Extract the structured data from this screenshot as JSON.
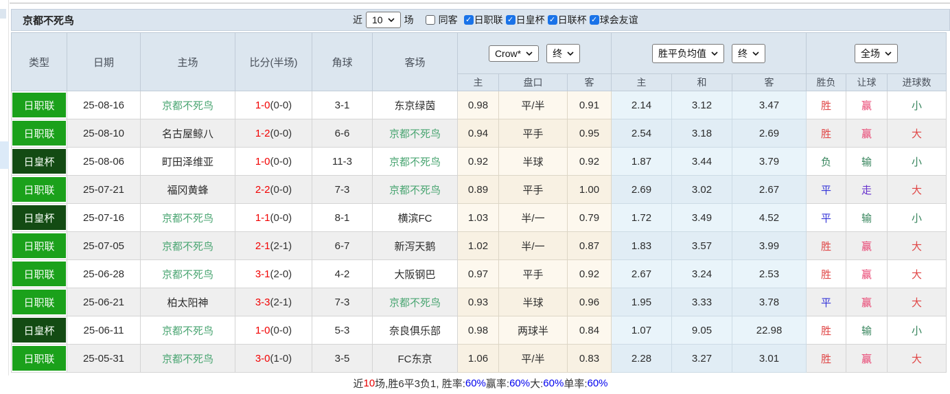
{
  "page": {
    "title_team": "京都不死鸟",
    "filters": {
      "near_label": "近",
      "near_value": "10",
      "matches_label": "场",
      "same_away_label": "同客",
      "same_away_checked": false,
      "leagues": [
        {
          "label": "日职联",
          "checked": true
        },
        {
          "label": "日皇杯",
          "checked": true
        },
        {
          "label": "日联杯",
          "checked": true
        },
        {
          "label": "球会友谊",
          "checked": true
        }
      ]
    }
  },
  "table": {
    "columns": [
      "类型",
      "日期",
      "主场",
      "比分(半场)",
      "角球",
      "客场"
    ],
    "odds_controls": {
      "bookmaker": "Crow*",
      "bookmaker_state": "终",
      "average": "胜平负均值",
      "average_state": "终",
      "scope": "全场"
    },
    "sub_columns": [
      "主",
      "盘口",
      "客",
      "主",
      "和",
      "客",
      "胜负",
      "让球",
      "进球数"
    ],
    "rows": [
      {
        "league": "日职联",
        "league_type": "league",
        "date": "25-08-16",
        "home": "京都不死鸟",
        "home_focus": true,
        "score": "1-0",
        "half": "(0-0)",
        "corners": "3-1",
        "away": "东京绿茵",
        "away_focus": false,
        "ah_home": "0.98",
        "ah_line": "平/半",
        "ah_away": "0.91",
        "avg_home": "2.14",
        "avg_draw": "3.12",
        "avg_away": "3.47",
        "result": "胜",
        "result_color": "red",
        "handicap": "赢",
        "handicap_color": "pink",
        "goals": "小",
        "goals_color": "green"
      },
      {
        "league": "日职联",
        "league_type": "league",
        "date": "25-08-10",
        "home": "名古屋鲸八",
        "home_focus": false,
        "score": "1-2",
        "half": "(0-0)",
        "corners": "6-6",
        "away": "京都不死鸟",
        "away_focus": true,
        "ah_home": "0.94",
        "ah_line": "平手",
        "ah_away": "0.95",
        "avg_home": "2.54",
        "avg_draw": "3.18",
        "avg_away": "2.69",
        "result": "胜",
        "result_color": "red",
        "handicap": "赢",
        "handicap_color": "pink",
        "goals": "大",
        "goals_color": "red"
      },
      {
        "league": "日皇杯",
        "league_type": "cup",
        "date": "25-08-06",
        "home": "町田泽维亚",
        "home_focus": false,
        "score": "1-0",
        "half": "(0-0)",
        "corners": "11-3",
        "away": "京都不死鸟",
        "away_focus": true,
        "ah_home": "0.92",
        "ah_line": "半球",
        "ah_away": "0.92",
        "avg_home": "1.87",
        "avg_draw": "3.44",
        "avg_away": "3.79",
        "result": "负",
        "result_color": "green",
        "handicap": "输",
        "handicap_color": "green",
        "goals": "小",
        "goals_color": "green"
      },
      {
        "league": "日职联",
        "league_type": "league",
        "date": "25-07-21",
        "home": "福冈黄蜂",
        "home_focus": false,
        "score": "2-2",
        "half": "(0-0)",
        "corners": "7-3",
        "away": "京都不死鸟",
        "away_focus": true,
        "ah_home": "0.89",
        "ah_line": "平手",
        "ah_away": "1.00",
        "avg_home": "2.69",
        "avg_draw": "3.02",
        "avg_away": "2.67",
        "result": "平",
        "result_color": "blue",
        "handicap": "走",
        "handicap_color": "violet",
        "goals": "大",
        "goals_color": "red"
      },
      {
        "league": "日皇杯",
        "league_type": "cup",
        "date": "25-07-16",
        "home": "京都不死鸟",
        "home_focus": true,
        "score": "1-1",
        "half": "(0-0)",
        "corners": "8-1",
        "away": "横滨FC",
        "away_focus": false,
        "ah_home": "1.03",
        "ah_line": "半/一",
        "ah_away": "0.79",
        "avg_home": "1.72",
        "avg_draw": "3.49",
        "avg_away": "4.52",
        "result": "平",
        "result_color": "blue",
        "handicap": "输",
        "handicap_color": "green",
        "goals": "小",
        "goals_color": "green"
      },
      {
        "league": "日职联",
        "league_type": "league",
        "date": "25-07-05",
        "home": "京都不死鸟",
        "home_focus": true,
        "score": "2-1",
        "half": "(2-1)",
        "corners": "6-7",
        "away": "新泻天鹅",
        "away_focus": false,
        "ah_home": "1.02",
        "ah_line": "半/一",
        "ah_away": "0.87",
        "avg_home": "1.83",
        "avg_draw": "3.57",
        "avg_away": "3.99",
        "result": "胜",
        "result_color": "red",
        "handicap": "赢",
        "handicap_color": "pink",
        "goals": "大",
        "goals_color": "red"
      },
      {
        "league": "日职联",
        "league_type": "league",
        "date": "25-06-28",
        "home": "京都不死鸟",
        "home_focus": true,
        "score": "3-1",
        "half": "(2-0)",
        "corners": "4-2",
        "away": "大阪钢巴",
        "away_focus": false,
        "ah_home": "0.97",
        "ah_line": "平手",
        "ah_away": "0.92",
        "avg_home": "2.67",
        "avg_draw": "3.24",
        "avg_away": "2.53",
        "result": "胜",
        "result_color": "red",
        "handicap": "赢",
        "handicap_color": "pink",
        "goals": "大",
        "goals_color": "red"
      },
      {
        "league": "日职联",
        "league_type": "league",
        "date": "25-06-21",
        "home": "柏太阳神",
        "home_focus": false,
        "score": "3-3",
        "half": "(2-1)",
        "corners": "7-3",
        "away": "京都不死鸟",
        "away_focus": true,
        "ah_home": "0.93",
        "ah_line": "半球",
        "ah_away": "0.96",
        "avg_home": "1.95",
        "avg_draw": "3.33",
        "avg_away": "3.78",
        "result": "平",
        "result_color": "blue",
        "handicap": "赢",
        "handicap_color": "pink",
        "goals": "大",
        "goals_color": "red"
      },
      {
        "league": "日皇杯",
        "league_type": "cup",
        "date": "25-06-11",
        "home": "京都不死鸟",
        "home_focus": true,
        "score": "1-0",
        "half": "(0-0)",
        "corners": "5-3",
        "away": "奈良俱乐部",
        "away_focus": false,
        "ah_home": "0.98",
        "ah_line": "两球半",
        "ah_away": "0.84",
        "avg_home": "1.07",
        "avg_draw": "9.05",
        "avg_away": "22.98",
        "result": "胜",
        "result_color": "red",
        "handicap": "输",
        "handicap_color": "green",
        "goals": "小",
        "goals_color": "green"
      },
      {
        "league": "日职联",
        "league_type": "league",
        "date": "25-05-31",
        "home": "京都不死鸟",
        "home_focus": true,
        "score": "3-0",
        "half": "(1-0)",
        "corners": "3-5",
        "away": "FC东京",
        "away_focus": false,
        "ah_home": "1.06",
        "ah_line": "平/半",
        "ah_away": "0.83",
        "avg_home": "2.28",
        "avg_draw": "3.27",
        "avg_away": "3.01",
        "result": "胜",
        "result_color": "red",
        "handicap": "赢",
        "handicap_color": "pink",
        "goals": "大",
        "goals_color": "red"
      }
    ]
  },
  "footer": {
    "segments": [
      {
        "text": "近",
        "color": "dark"
      },
      {
        "text": "10",
        "color": "red"
      },
      {
        "text": "场,胜6平3负1, 胜率:",
        "color": "dark"
      },
      {
        "text": "60%",
        "color": "blue"
      },
      {
        "text": " 赢率:",
        "color": "dark"
      },
      {
        "text": "60%",
        "color": "blue"
      },
      {
        "text": " 大:",
        "color": "dark"
      },
      {
        "text": "60%",
        "color": "blue"
      },
      {
        "text": " 单率:",
        "color": "dark"
      },
      {
        "text": "60%",
        "color": "blue"
      }
    ]
  },
  "colors": {
    "league_green": "#1ba11b",
    "cup_green": "#134b13",
    "focus_team": "#4aa572",
    "score_red": "#f20000",
    "win_red": "#e04646",
    "handicap_pink": "#e8416f",
    "under_green": "#36845c",
    "draw_blue": "#3434d8",
    "push_violet": "#6630cc",
    "percent_blue": "#0000ee"
  }
}
